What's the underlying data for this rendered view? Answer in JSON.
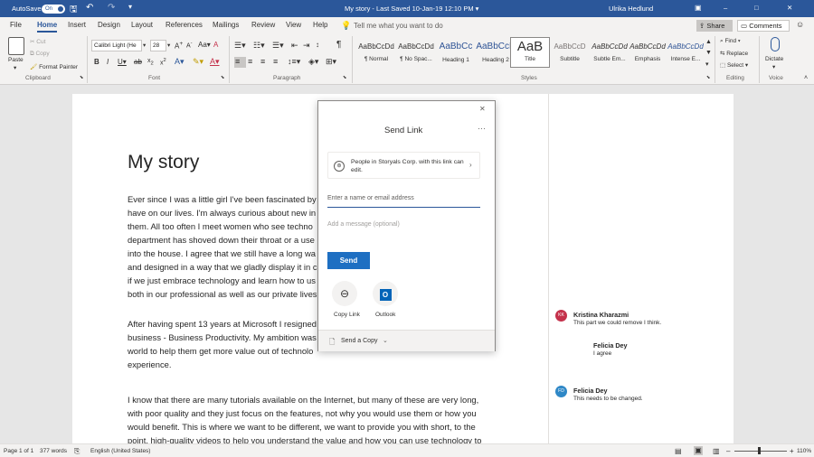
{
  "titlebar": {
    "autosave_label": "AutoSave",
    "autosave_state": "On",
    "doc_title": "My story  -  Last Saved 10-Jan-19 12:10 PM  ▾",
    "search_placeholder": "Tell me what you want to do",
    "user": "Ulrika Hedlund",
    "minimize": "–",
    "maximize": "□",
    "close": "✕"
  },
  "tabs": [
    "File",
    "Home",
    "Insert",
    "Design",
    "Layout",
    "References",
    "Mailings",
    "Review",
    "View",
    "Help"
  ],
  "share_label": "Share",
  "comments_label": "Comments",
  "ribbon": {
    "clipboard": {
      "paste": "Paste",
      "cut": "Cut",
      "copy": "Copy",
      "format_painter": "Format Painter",
      "group": "Clipboard"
    },
    "font": {
      "name": "Calibri Light (He",
      "size": "28",
      "group": "Font"
    },
    "paragraph": {
      "group": "Paragraph"
    },
    "styles": {
      "group": "Styles",
      "items": [
        {
          "preview": "AaBbCcDd",
          "name": "¶ Normal"
        },
        {
          "preview": "AaBbCcDd",
          "name": "¶ No Spac..."
        },
        {
          "preview": "AaBbCc",
          "name": "Heading 1"
        },
        {
          "preview": "AaBbCcE",
          "name": "Heading 2"
        },
        {
          "preview": "AaB",
          "name": "Title"
        },
        {
          "preview": "AaBbCcD",
          "name": "Subtitle"
        },
        {
          "preview": "AaBbCcDd",
          "name": "Subtle Em..."
        },
        {
          "preview": "AaBbCcDd",
          "name": "Emphasis"
        },
        {
          "preview": "AaBbCcDd",
          "name": "Intense E..."
        }
      ]
    },
    "editing": {
      "find": "Find",
      "replace": "Replace",
      "select": "Select",
      "group": "Editing"
    },
    "voice": {
      "dictate": "Dictate",
      "group": "Voice"
    }
  },
  "document": {
    "title": "My story",
    "p1": [
      "Ever since I was a little girl I've been fascinated by",
      "have on our lives. I'm always curious about new in",
      "them. All too often I meet women who see techno",
      "department has shoved down their throat or a use",
      "into the house. I agree that we still have a long wa",
      "and designed in a way that we gladly display it in c",
      "if we just embrace technology and learn how to us",
      "both in our professional as well as our private lives"
    ],
    "p2": [
      "After having spent 13 years at Microsoft I resigned",
      "business - Business Productivity. My ambition was",
      "world to help them get more value out of technolo",
      "experience."
    ],
    "p3": [
      "I know that there are many tutorials available on the Internet, but many of these are very long,",
      "with poor quality and they just focus on the features, not why you would use them or how you",
      "would benefit. This is where we want to be different, we want to provide you with short, to the",
      "point, high-quality videos to help you understand the value and how you can use technology to"
    ]
  },
  "comments": [
    {
      "initials": "KK",
      "author": "Kristina Kharazmi",
      "text": "This part we could remove I think.",
      "color": "#c4314b"
    },
    {
      "initials": "",
      "author": "Felicia Dey",
      "text": "I agree",
      "color": ""
    },
    {
      "initials": "FD",
      "author": "Felicia Dey",
      "text": "This needs to be changed.",
      "color": "#2f88c7"
    }
  ],
  "dialog": {
    "title": "Send Link",
    "more": "···",
    "close": "✕",
    "permission": "People in Storyals Corp. with this link can edit.",
    "name_placeholder": "Enter a name or email address",
    "message_placeholder": "Add a message (optional)",
    "send": "Send",
    "copy_link": "Copy Link",
    "outlook": "Outlook",
    "send_copy": "Send a Copy"
  },
  "statusbar": {
    "page": "Page 1 of 1",
    "words": "377 words",
    "language": "English (United States)",
    "zoom": "110%"
  }
}
